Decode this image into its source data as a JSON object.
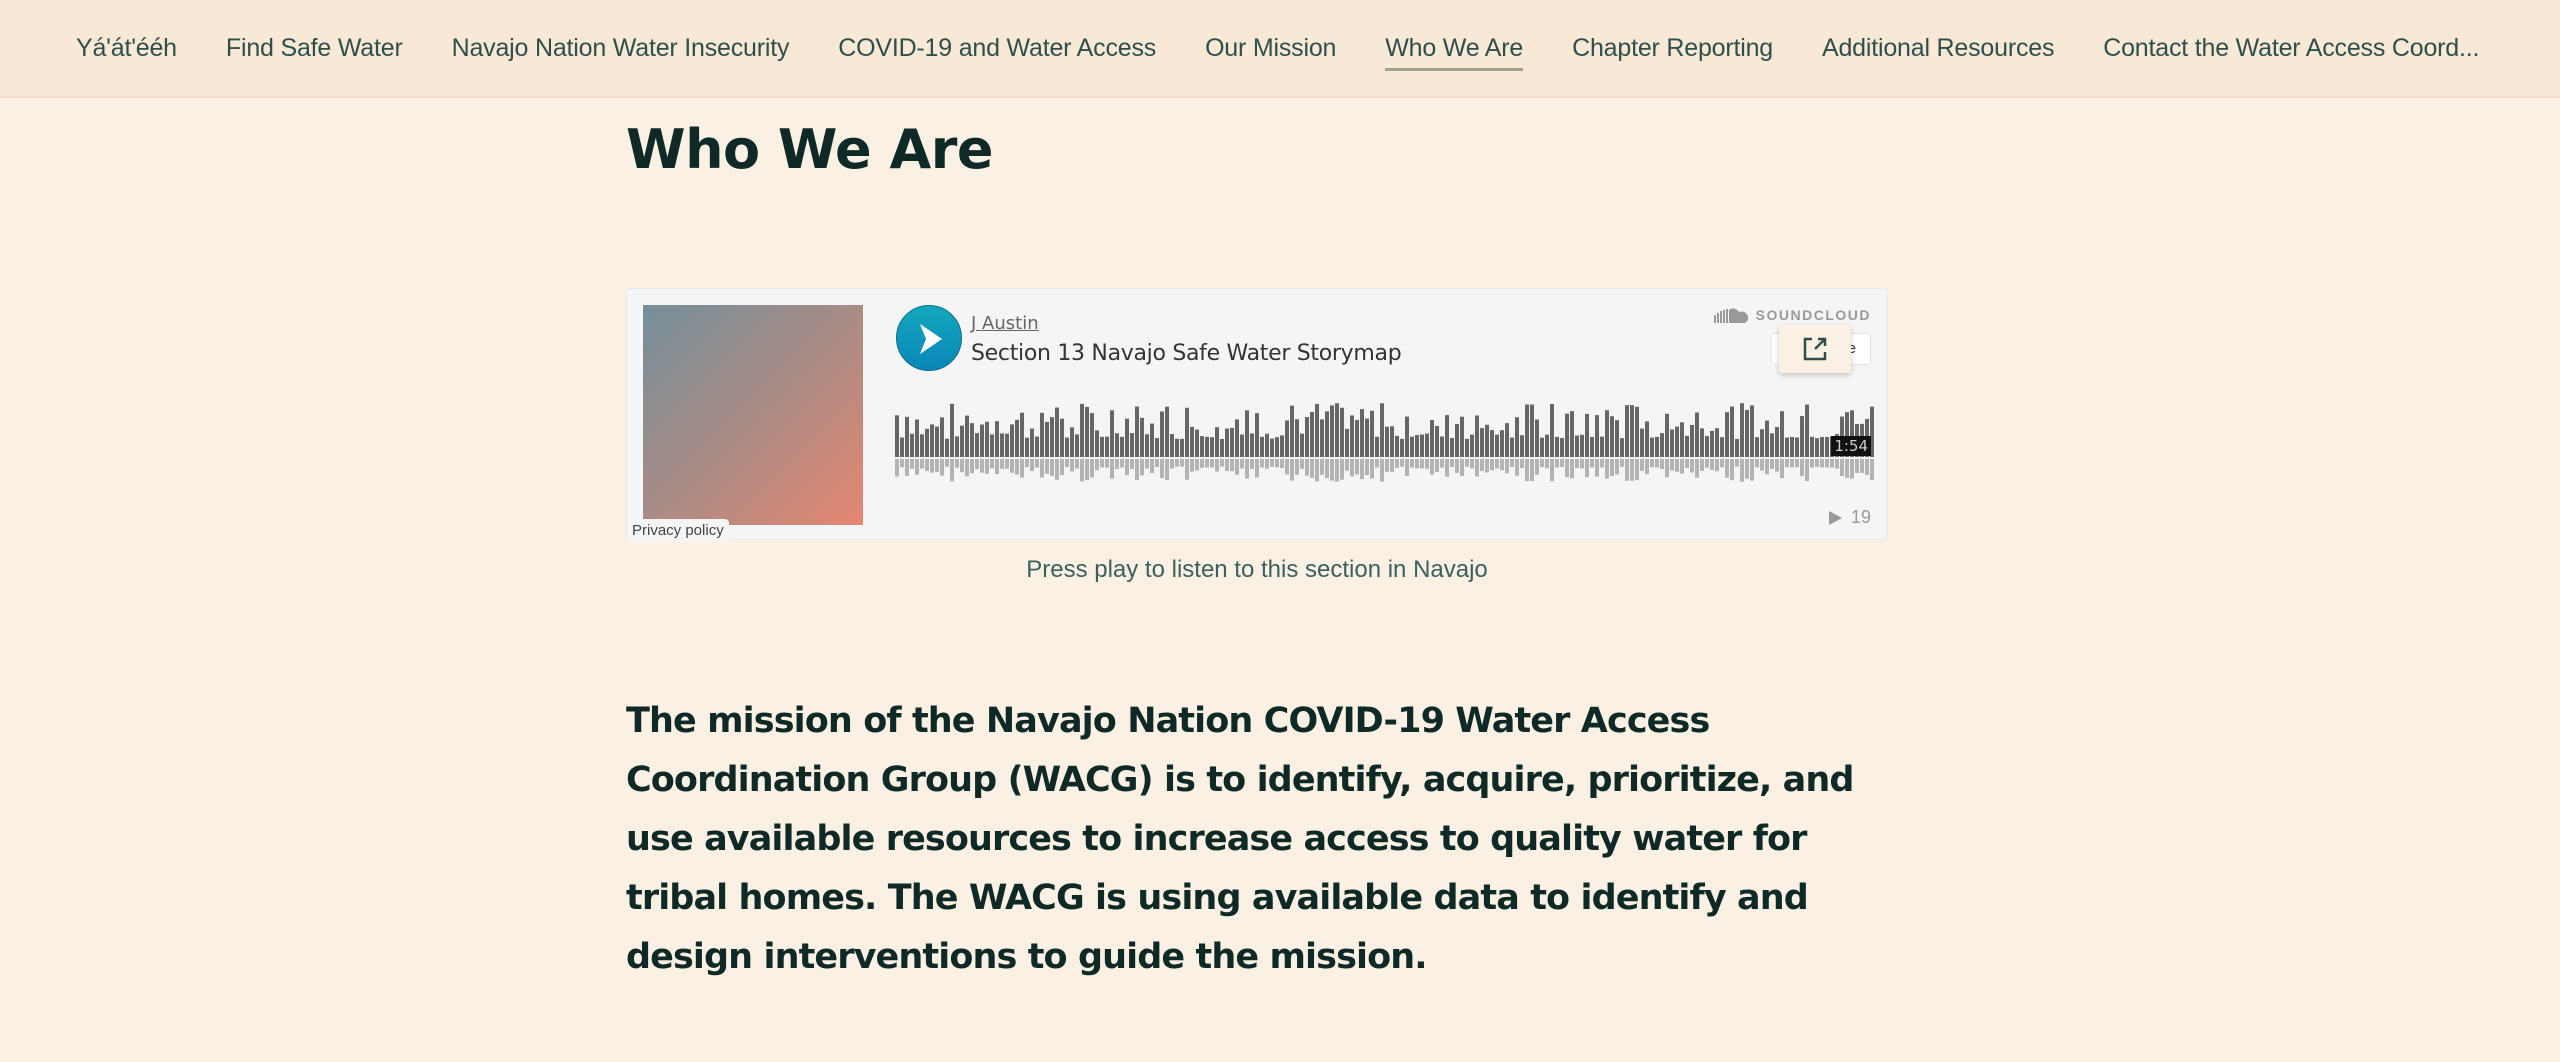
{
  "nav": {
    "items": [
      {
        "label": "Yá'át'ééh",
        "active": false
      },
      {
        "label": "Find Safe Water",
        "active": false
      },
      {
        "label": "Navajo Nation Water Insecurity",
        "active": false
      },
      {
        "label": "COVID-19 and Water Access",
        "active": false
      },
      {
        "label": "Our Mission",
        "active": false
      },
      {
        "label": "Who We Are",
        "active": true
      },
      {
        "label": "Chapter Reporting",
        "active": false
      },
      {
        "label": "Additional Resources",
        "active": false
      },
      {
        "label": "Contact the Water Access Coord..."
      }
    ]
  },
  "page": {
    "title": "Who We Are"
  },
  "player": {
    "artist": "J  Austin",
    "track_title": "Section 13 Navajo Safe Water Storymap",
    "brand": "SOUNDCLOUD",
    "share_label": "Share",
    "duration": "1:54",
    "play_count": "19",
    "privacy_label": "Privacy policy",
    "play_icon": "play-icon",
    "popout_icon": "external-link-icon",
    "accent_color": "#0f9fc0"
  },
  "caption": "Press play to listen to this section in Navajo",
  "mission_text": "The mission of the Navajo Nation COVID-19 Water Access Coordination Group (WACG) is to identify, acquire, prioritize, and use available resources to increase access to quality water for tribal homes. The WACG is using available data to identify and design interventions to guide the mission."
}
